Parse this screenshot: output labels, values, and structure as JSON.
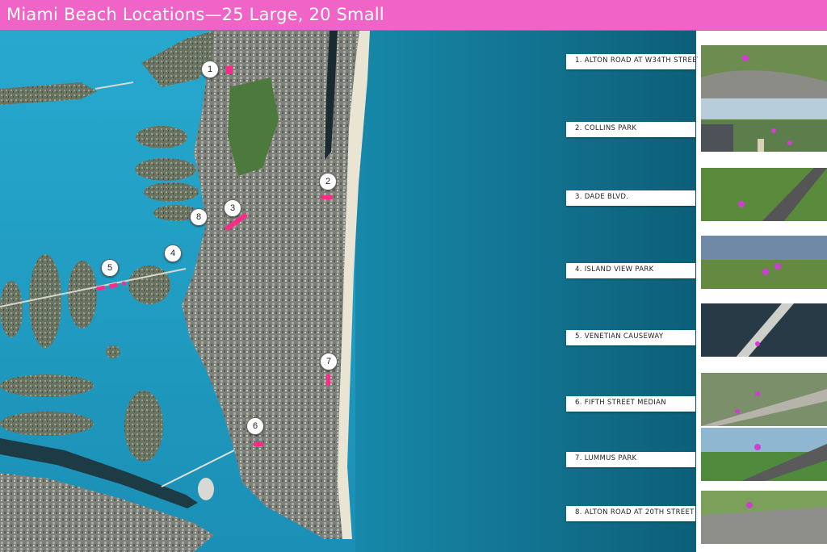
{
  "title": "Miami Beach Locations—25 Large, 20 Small",
  "colors": {
    "title_bar": "#f064c8",
    "water": "#1fa6c6",
    "ocean_deep": "#0f6e86",
    "marker_pink": "#ff2a8a"
  },
  "markers": [
    "1",
    "2",
    "3",
    "4",
    "5",
    "6",
    "7",
    "8"
  ],
  "locations": [
    {
      "label": "1. ALTON ROAD AT W34TH STREET"
    },
    {
      "label": "2. COLLINS PARK"
    },
    {
      "label": "3. DADE BLVD."
    },
    {
      "label": "4. ISLAND VIEW PARK"
    },
    {
      "label": "5. VENETIAN CAUSEWAY"
    },
    {
      "label": "6. FIFTH STREET MEDIAN"
    },
    {
      "label": "7. LUMMUS PARK"
    },
    {
      "label": "8. ALTON ROAD AT 20TH STREET"
    }
  ]
}
